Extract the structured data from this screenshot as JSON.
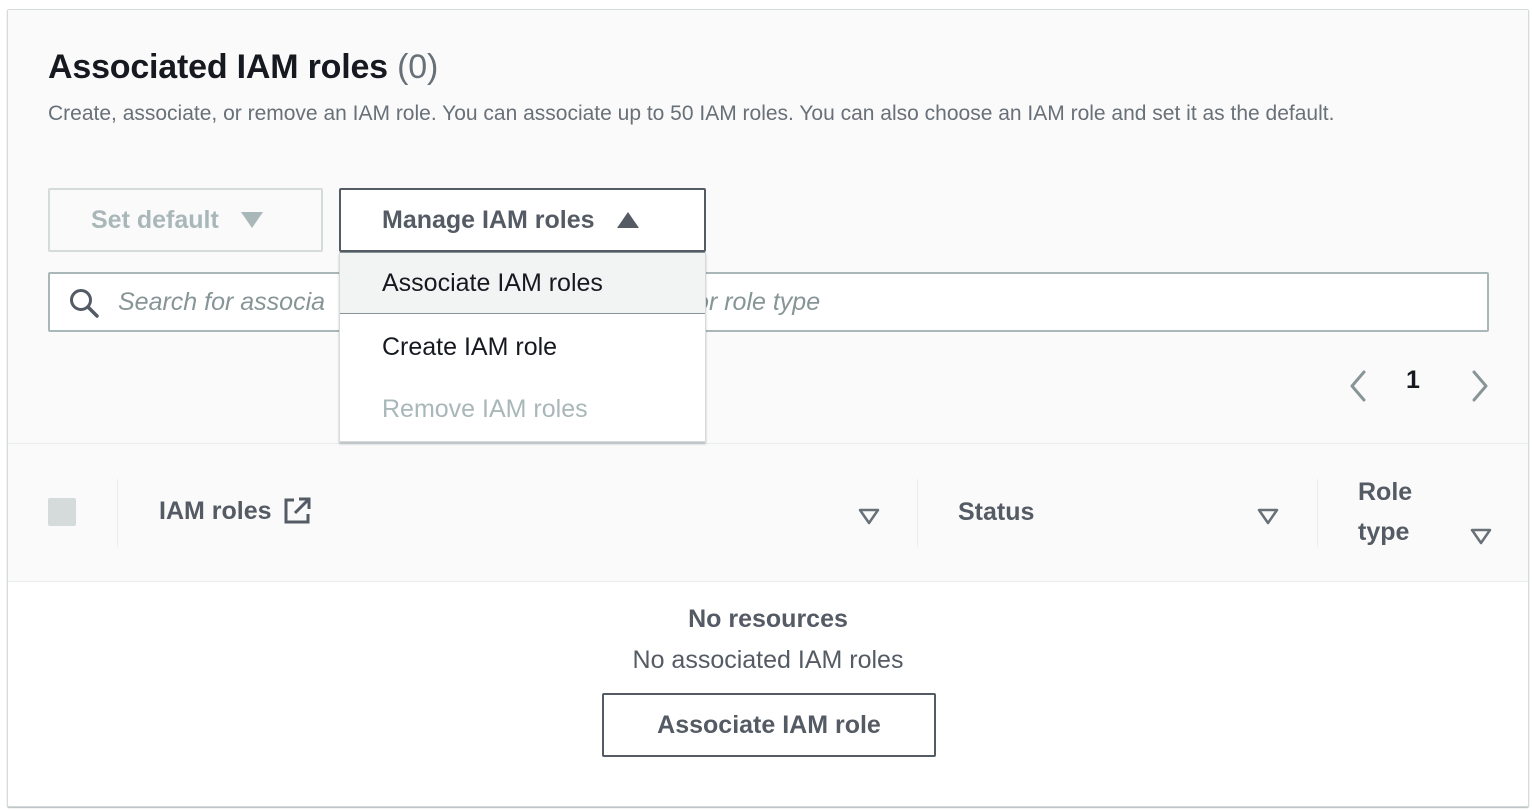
{
  "section": {
    "title": "Associated IAM roles",
    "count": "(0)",
    "description": "Create, associate, or remove an IAM role. You can associate up to 50 IAM roles. You can also choose an IAM role and set it as the default."
  },
  "actions": {
    "set_default_label": "Set default",
    "manage_label": "Manage IAM roles"
  },
  "dropdown": {
    "items": [
      {
        "label": "Associate IAM roles",
        "state": "hover"
      },
      {
        "label": "Create IAM role",
        "state": "enabled"
      },
      {
        "label": "Remove IAM roles",
        "state": "disabled"
      }
    ]
  },
  "search": {
    "visible_left": "Search for associa",
    "visible_right": "or role type"
  },
  "pagination": {
    "current_page": "1"
  },
  "table": {
    "columns": [
      {
        "label": "IAM roles",
        "icon": "external-link-icon"
      },
      {
        "label": "Status"
      },
      {
        "label_line1": "Role",
        "label_line2": "type"
      }
    ]
  },
  "empty_state": {
    "title": "No resources",
    "subtitle": "No associated IAM roles",
    "button_label": "Associate IAM role"
  },
  "colors": {
    "text_primary": "#16191f",
    "text_secondary": "#545b64",
    "text_muted": "#687078",
    "disabled": "#aab7b8",
    "border": "#d5dbdb"
  }
}
